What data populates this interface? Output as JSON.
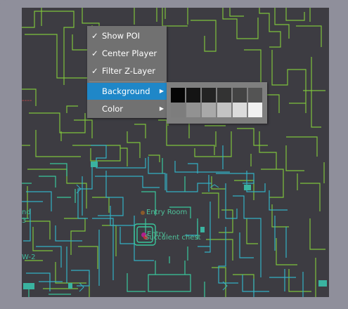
{
  "map": {
    "labels": {
      "entry_room": "Entry Room",
      "entry": "Entry",
      "poi": "Succulent chest",
      "edge_top": "nd",
      "edge_mid": "3",
      "edge_bottom": "W-2",
      "red_marker": "----"
    },
    "markers": [
      {
        "name": "entry-room-marker",
        "color": "#8a5a2a"
      },
      {
        "name": "player-marker",
        "color": "#b0208c"
      },
      {
        "name": "poi-marker",
        "color": "#c0303c"
      }
    ],
    "colors": {
      "background": "#3d3c42",
      "walls_green": "#7ec23c",
      "walls_cyan": "#33b0c4",
      "walls_teal": "#3ac79c"
    }
  },
  "menu": {
    "items": [
      {
        "label": "Show POI",
        "checked": true,
        "submenu": false
      },
      {
        "label": "Center Player",
        "checked": true,
        "submenu": false
      },
      {
        "label": "Filter Z-Layer",
        "checked": true,
        "submenu": false
      },
      {
        "label": "Background",
        "checked": false,
        "submenu": true,
        "highlighted": true
      },
      {
        "label": "Color",
        "checked": false,
        "submenu": true
      }
    ],
    "check_glyph": "✓",
    "submenu_glyph": "▶"
  },
  "background_palette": {
    "row1": [
      "#050505",
      "#141414",
      "#232323",
      "#333333",
      "#434343",
      "#545454"
    ],
    "row2": [
      "#7d7d7d",
      "#929292",
      "#a9a9a9",
      "#c3c3c3",
      "#dbdbdb",
      "#f1f1f1"
    ]
  }
}
